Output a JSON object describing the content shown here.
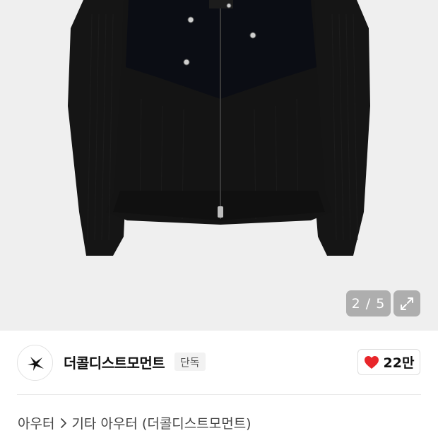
{
  "gallery": {
    "current_page": "2 / 5",
    "expand_icon": "expand-arrows-icon"
  },
  "brand": {
    "name": "더콜디스트모먼트",
    "badge": "단독",
    "logo_icon": "brand-star-logo-icon"
  },
  "like": {
    "icon": "heart-icon",
    "count": "22만",
    "color": "#e8262a"
  },
  "breadcrumb": {
    "items": [
      "아우터",
      "기타 아우터 (더콜디스트모먼트)"
    ],
    "separator_icon": "chevron-right-icon"
  }
}
